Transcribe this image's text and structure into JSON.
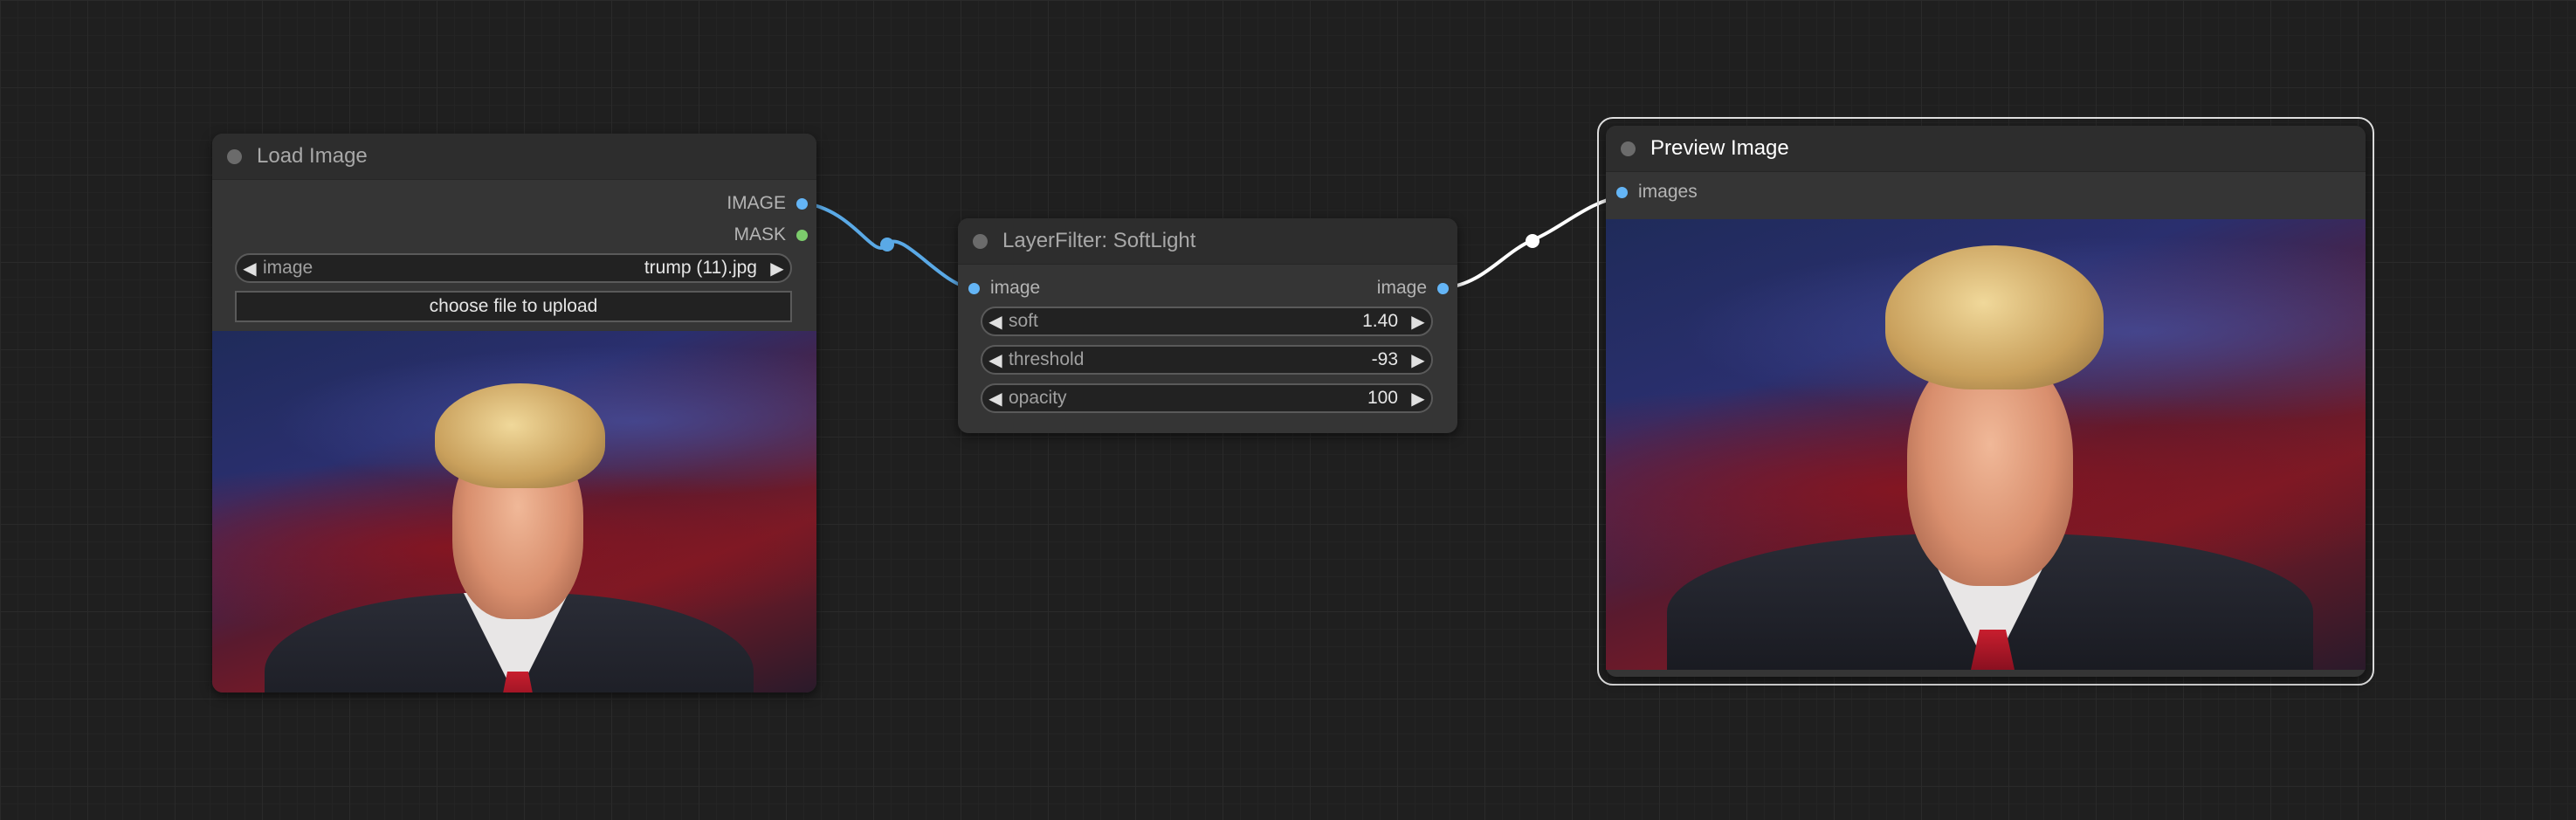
{
  "nodes": {
    "load_image": {
      "title": "Load Image",
      "outputs": [
        "IMAGE",
        "MASK"
      ],
      "image_widget": {
        "label": "image",
        "value": "trump (11).jpg"
      },
      "upload_label": "choose file to upload"
    },
    "softlight": {
      "title": "LayerFilter: SoftLight",
      "input": "image",
      "output": "image",
      "widgets": [
        {
          "label": "soft",
          "value": "1.40"
        },
        {
          "label": "threshold",
          "value": "-93"
        },
        {
          "label": "opacity",
          "value": "100"
        }
      ]
    },
    "preview": {
      "title": "Preview Image",
      "input": "images"
    }
  },
  "icons": {
    "left_arrow": "◀",
    "right_arrow": "▶"
  },
  "colors": {
    "image_link": "#5aa9e6",
    "preview_link": "#ffffff",
    "mask_slot": "#7ccc6c"
  }
}
